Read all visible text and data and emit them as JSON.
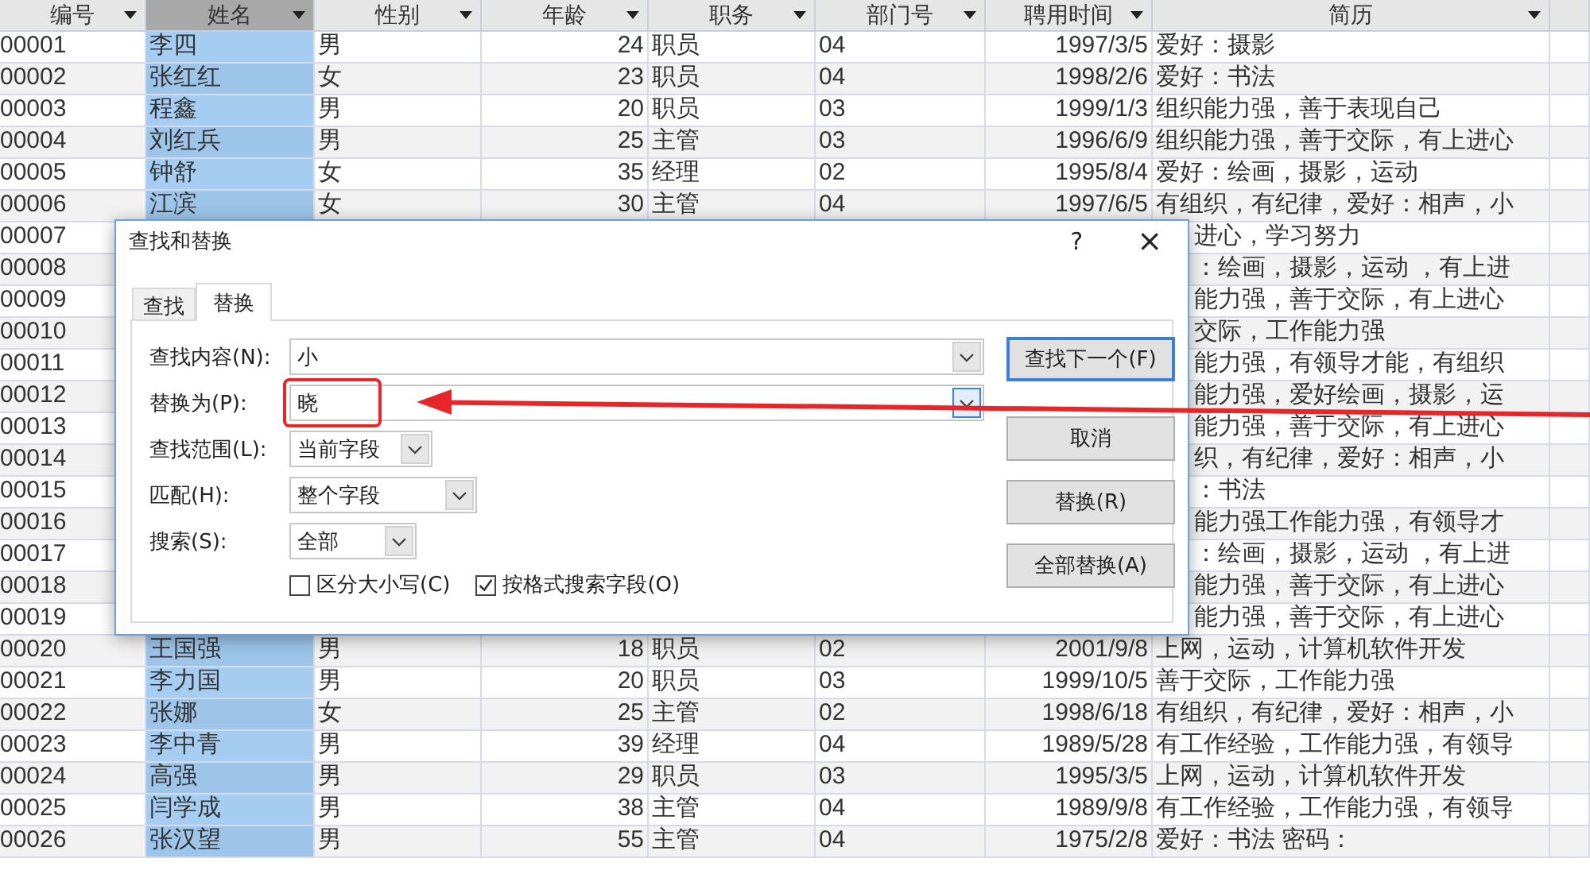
{
  "table": {
    "columns": [
      {
        "label": "编号",
        "selected": false
      },
      {
        "label": "姓名",
        "selected": true
      },
      {
        "label": "性别",
        "selected": false
      },
      {
        "label": "年龄",
        "selected": false
      },
      {
        "label": "职务",
        "selected": false
      },
      {
        "label": "部门号",
        "selected": false
      },
      {
        "label": "聘用时间",
        "selected": false
      },
      {
        "label": "简历",
        "selected": false
      }
    ],
    "rows": [
      {
        "cells": [
          "00001",
          "李四",
          "男",
          "24",
          "职员",
          "04",
          "1997/3/5",
          "爱好：摄影"
        ]
      },
      {
        "cells": [
          "00002",
          "张红红",
          "女",
          "23",
          "职员",
          "04",
          "1998/2/6",
          "爱好：书法"
        ]
      },
      {
        "cells": [
          "00003",
          "程鑫",
          "男",
          "20",
          "职员",
          "03",
          "1999/1/3",
          "组织能力强，善于表现自己"
        ]
      },
      {
        "cells": [
          "00004",
          "刘红兵",
          "男",
          "25",
          "主管",
          "03",
          "1996/6/9",
          "组织能力强，善于交际，有上进心"
        ]
      },
      {
        "cells": [
          "00005",
          "钟舒",
          "女",
          "35",
          "经理",
          "02",
          "1995/8/4",
          "爱好：绘画，摄影，运动"
        ]
      },
      {
        "cells": [
          "00006",
          "江滨",
          "女",
          "30",
          "主管",
          "04",
          "1997/6/5",
          "有组织，有纪律，爱好：相声，小"
        ]
      },
      {
        "cells": [
          "00007",
          "进心，学习努力"
        ]
      },
      {
        "cells": [
          "00008",
          "：绘画，摄影，运动 ，有上进"
        ]
      },
      {
        "cells": [
          "00009",
          "能力强，善于交际，有上进心"
        ]
      },
      {
        "cells": [
          "00010",
          "交际，工作能力强"
        ]
      },
      {
        "cells": [
          "00011",
          "能力强，有领导才能，有组织"
        ]
      },
      {
        "cells": [
          "00012",
          "能力强，爱好绘画，摄影，运"
        ]
      },
      {
        "cells": [
          "00013",
          "能力强，善于交际，有上进心"
        ]
      },
      {
        "cells": [
          "00014",
          "织，有纪律，爱好：相声，小"
        ]
      },
      {
        "cells": [
          "00015",
          "：书法"
        ]
      },
      {
        "cells": [
          "00016",
          "能力强工作能力强，有领导才"
        ]
      },
      {
        "cells": [
          "00017",
          "：绘画，摄影，运动 ，有上进"
        ]
      },
      {
        "cells": [
          "00018",
          "能力强，善于交际，有上进心"
        ]
      },
      {
        "cells": [
          "00019",
          "能力强，善于交际，有上进心"
        ]
      },
      {
        "cells": [
          "00020",
          "王国强",
          "男",
          "18",
          "职员",
          "02",
          "2001/9/8",
          "上网，运动，计算机软件开发"
        ]
      },
      {
        "cells": [
          "00021",
          "李力国",
          "男",
          "20",
          "职员",
          "03",
          "1999/10/5",
          "善于交际，工作能力强"
        ]
      },
      {
        "cells": [
          "00022",
          "张娜",
          "女",
          "25",
          "主管",
          "02",
          "1998/6/18",
          "有组织，有纪律，爱好：相声，小"
        ]
      },
      {
        "cells": [
          "00023",
          "李中青",
          "男",
          "39",
          "经理",
          "04",
          "1989/5/28",
          "有工作经验，工作能力强，有领导"
        ]
      },
      {
        "cells": [
          "00024",
          "高强",
          "男",
          "29",
          "职员",
          "03",
          "1995/3/5",
          "上网，运动，计算机软件开发"
        ]
      },
      {
        "cells": [
          "00025",
          "闫学成",
          "男",
          "38",
          "主管",
          "04",
          "1989/9/8",
          "有工作经验，工作能力强，有领导"
        ]
      },
      {
        "cells": [
          "00026",
          "张汉望",
          "男",
          "55",
          "主管",
          "04",
          "1975/2/8",
          "爱好：书法 密码："
        ]
      }
    ]
  },
  "dialog": {
    "title": "查找和替换",
    "help": "?",
    "close": "×",
    "tabs": [
      {
        "label": "查找",
        "selected": false
      },
      {
        "label": "替换",
        "selected": true
      }
    ],
    "fields": [
      {
        "label": "查找内容(N):",
        "value": "小",
        "focused": false
      },
      {
        "label": "替换为(P):",
        "value": "晓",
        "focused": true
      },
      {
        "label": "查找范围(L):",
        "value": "当前字段",
        "focused": false
      },
      {
        "label": "匹配(H):",
        "value": "整个字段",
        "focused": false
      },
      {
        "label": "搜索(S):",
        "value": "全部",
        "focused": false
      }
    ],
    "options": [
      {
        "label": "区分大小写(C)",
        "checked": false
      },
      {
        "label": "按格式搜索字段(O)",
        "checked": true
      }
    ],
    "buttons": [
      {
        "label": "查找下一个(F)",
        "default": true
      },
      {
        "label": "取消",
        "default": false
      },
      {
        "label": "替换(R)",
        "default": false
      },
      {
        "label": "全部替换(A)",
        "default": false
      }
    ]
  },
  "callouts": {
    "box": true,
    "arrow": true
  }
}
